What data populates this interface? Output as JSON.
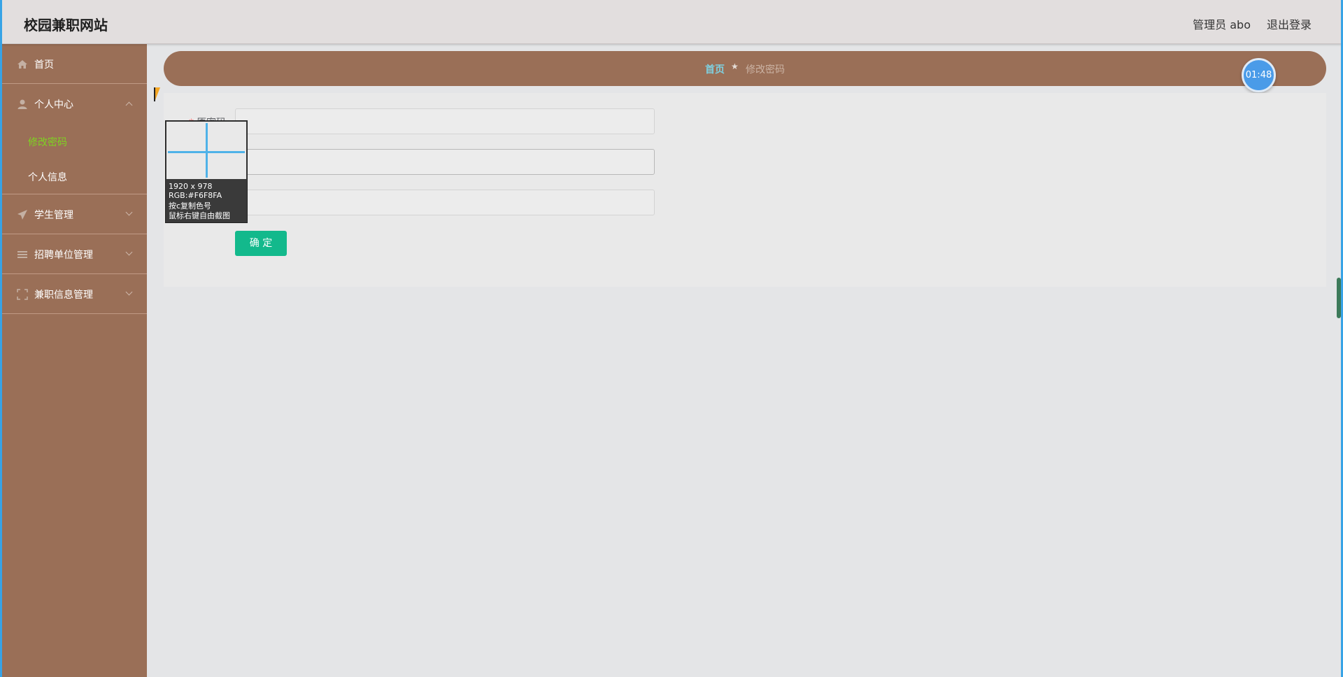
{
  "header": {
    "site_title": "校园兼职网站",
    "user_label": "管理员 abo",
    "logout_label": "退出登录"
  },
  "sidebar": {
    "items": [
      {
        "label": "首页",
        "icon": "home-icon"
      },
      {
        "label": "个人中心",
        "icon": "user-icon",
        "expanded": true,
        "children": [
          {
            "label": "修改密码",
            "active": true
          },
          {
            "label": "个人信息",
            "active": false
          }
        ]
      },
      {
        "label": "学生管理",
        "icon": "send-icon"
      },
      {
        "label": "招聘单位管理",
        "icon": "list-icon"
      },
      {
        "label": "兼职信息管理",
        "icon": "expand-icon"
      }
    ]
  },
  "breadcrumb": {
    "home": "首页",
    "separator": "★",
    "current": "修改密码"
  },
  "clock": {
    "time": "01:48"
  },
  "form": {
    "fields": [
      {
        "label": "原密码",
        "required": true,
        "value": ""
      },
      {
        "label": "",
        "required": false,
        "value": ""
      },
      {
        "label": "",
        "required": false,
        "value": ""
      }
    ],
    "submit_label": "确 定"
  },
  "color_picker_overlay": {
    "dimensions": "1920 x 978",
    "rgb": "RGB:#F6F8FA",
    "copy_hint": "按c复制色号",
    "screenshot_hint": "鼠标右键自由截图"
  },
  "colors": {
    "sidebar_bg": "#9a6f57",
    "topbar_bg": "#e2dede",
    "active_submenu": "#7ed321",
    "breadcrumb_home": "#7fd0e0",
    "submit_button": "#13b98c",
    "clock_badge": "#4a9be8"
  }
}
